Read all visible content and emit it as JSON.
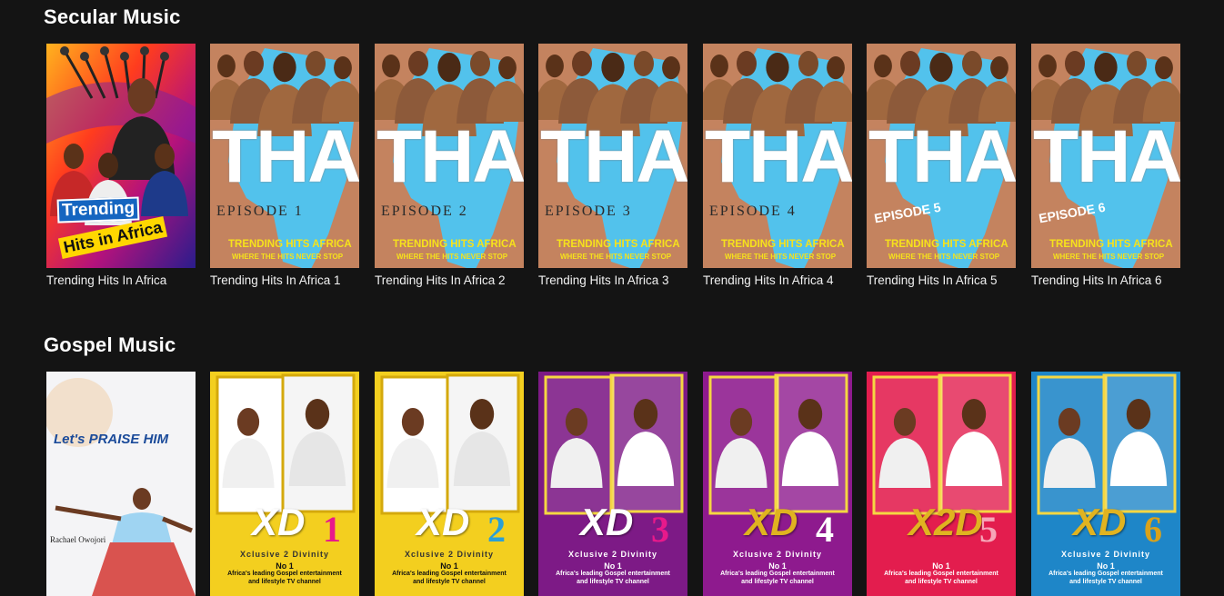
{
  "sections": [
    {
      "title": "Secular Music",
      "items": [
        {
          "caption": "Trending Hits In Africa",
          "poster": {
            "style": "trending-cover",
            "line1": "Trending",
            "line2": "Hits in Africa"
          }
        },
        {
          "caption": "Trending Hits In Africa 1",
          "poster": {
            "style": "tha",
            "big": "THA",
            "episode": "EPISODE 1",
            "tagline1": "TRENDING HITS AFRICA",
            "tagline2": "WHERE THE HITS NEVER STOP"
          }
        },
        {
          "caption": "Trending Hits In Africa 2",
          "poster": {
            "style": "tha",
            "big": "THA",
            "episode": "EPISODE 2",
            "tagline1": "TRENDING HITS AFRICA",
            "tagline2": "WHERE THE HITS NEVER STOP"
          }
        },
        {
          "caption": "Trending Hits In Africa 3",
          "poster": {
            "style": "tha",
            "big": "THA",
            "episode": "EPISODE 3",
            "tagline1": "TRENDING HITS AFRICA",
            "tagline2": "WHERE THE HITS NEVER STOP"
          }
        },
        {
          "caption": "Trending Hits In Africa 4",
          "poster": {
            "style": "tha",
            "big": "THA",
            "episode": "EPISODE 4",
            "tagline1": "TRENDING HITS AFRICA",
            "tagline2": "WHERE THE HITS NEVER STOP"
          }
        },
        {
          "caption": "Trending Hits In Africa 5",
          "poster": {
            "style": "tha",
            "big": "THA",
            "episode": "EPISODE 5",
            "tagline1": "TRENDING HITS AFRICA",
            "tagline2": "WHERE THE HITS NEVER STOP"
          }
        },
        {
          "caption": "Trending Hits In Africa 6",
          "poster": {
            "style": "tha",
            "big": "THA",
            "episode": "EPISODE 6",
            "tagline1": "TRENDING HITS AFRICA",
            "tagline2": "WHERE THE HITS NEVER STOP"
          }
        }
      ]
    },
    {
      "title": "Gospel Music",
      "items": [
        {
          "caption": "",
          "poster": {
            "style": "praise",
            "title": "Let's PRAISE HIM",
            "name": "Rachael Owojori"
          }
        },
        {
          "caption": "",
          "poster": {
            "style": "xd",
            "bg": "#f3cf1f",
            "logo": "XD",
            "num": "1",
            "numColor": "#e8198b",
            "sub": "Xclusive 2 Divinity",
            "no": "No 1",
            "tag1": "Africa's leading Gospel entertainment",
            "tag2": "and lifestyle TV channel"
          }
        },
        {
          "caption": "",
          "poster": {
            "style": "xd",
            "bg": "#f3cf1f",
            "logo": "XD",
            "num": "2",
            "numColor": "#2b9fd6",
            "sub": "Xclusive 2 Divinity",
            "no": "No 1",
            "tag1": "Africa's leading Gospel entertainment",
            "tag2": "and lifestyle TV channel"
          }
        },
        {
          "caption": "",
          "poster": {
            "style": "xd",
            "bg": "#7d1a86",
            "logo": "XD",
            "num": "3",
            "numColor": "#e8198b",
            "sub": "Xclusive 2 Divinity",
            "no": "No 1",
            "tag1": "Africa's leading Gospel entertainment",
            "tag2": "and lifestyle TV channel"
          }
        },
        {
          "caption": "",
          "poster": {
            "style": "xd",
            "bg": "#8e1a8e",
            "logo": "XD",
            "num": "4",
            "numColor": "#ffffff",
            "sub": "Xclusive 2 Divinity",
            "no": "No 1",
            "tag1": "Africa's leading Gospel entertainment",
            "tag2": "and lifestyle TV channel"
          }
        },
        {
          "caption": "",
          "poster": {
            "style": "xd",
            "bg": "#e31d4e",
            "logo": "X2D",
            "num": "5",
            "numColor": "#f6a6b8",
            "sub": "",
            "no": "No 1",
            "tag1": "Africa's leading Gospel entertainment",
            "tag2": "and lifestyle TV channel"
          }
        },
        {
          "caption": "",
          "poster": {
            "style": "xd",
            "bg": "#1e86c8",
            "logo": "XD",
            "num": "6",
            "numColor": "#d9a21b",
            "sub": "Xclusive 2 Divinity",
            "no": "No 1",
            "tag1": "Africa's leading Gospel entertainment",
            "tag2": "and lifestyle TV channel"
          }
        }
      ]
    }
  ],
  "colors": {
    "background": "#141414",
    "tha_sky": "#52c2ec",
    "tha_land": "#c4835f",
    "tha_yellow": "#f6e21b"
  }
}
